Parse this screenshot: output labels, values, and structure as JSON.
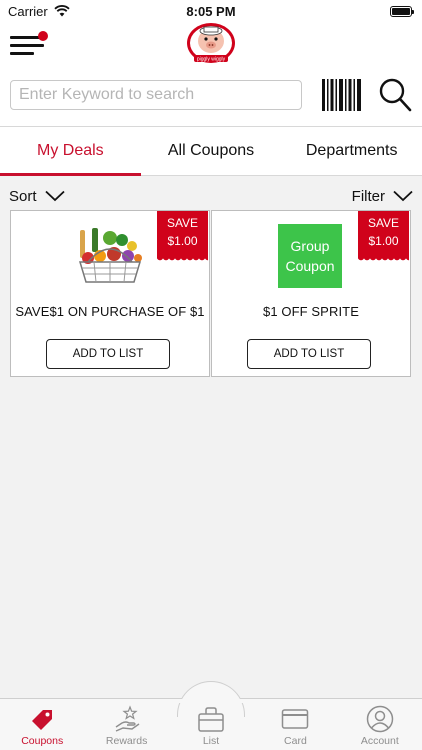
{
  "status_bar": {
    "carrier": "Carrier",
    "time": "8:05 PM"
  },
  "header": {
    "search": {
      "placeholder": "Enter Keyword to search",
      "value": ""
    },
    "logo_text": "piggly wiggly"
  },
  "tabs": [
    {
      "label": "My Deals",
      "active": true
    },
    {
      "label": "All Coupons",
      "active": false
    },
    {
      "label": "Departments",
      "active": false
    }
  ],
  "toolbar": {
    "sort_label": "Sort",
    "filter_label": "Filter"
  },
  "coupons": [
    {
      "save_label": "SAVE",
      "save_amount": "$1.00",
      "image": "grocery-basket",
      "title": "SAVE$1 ON PURCHASE OF $1",
      "button_label": "ADD TO LIST"
    },
    {
      "save_label": "SAVE",
      "save_amount": "$1.00",
      "image_text": "Group\nCoupon",
      "title": "$1 OFF SPRITE",
      "button_label": "ADD TO LIST"
    }
  ],
  "bottom_nav": [
    {
      "label": "Coupons",
      "icon": "tag-icon",
      "active": true
    },
    {
      "label": "Rewards",
      "icon": "rewards-icon",
      "active": false
    },
    {
      "label": "List",
      "icon": "list-bag-icon",
      "active": false
    },
    {
      "label": "Card",
      "icon": "card-icon",
      "active": false
    },
    {
      "label": "Account",
      "icon": "account-icon",
      "active": false
    }
  ],
  "colors": {
    "accent": "#c8102e",
    "save_tag": "#d0021b",
    "group_coupon": "#3dc44a"
  }
}
